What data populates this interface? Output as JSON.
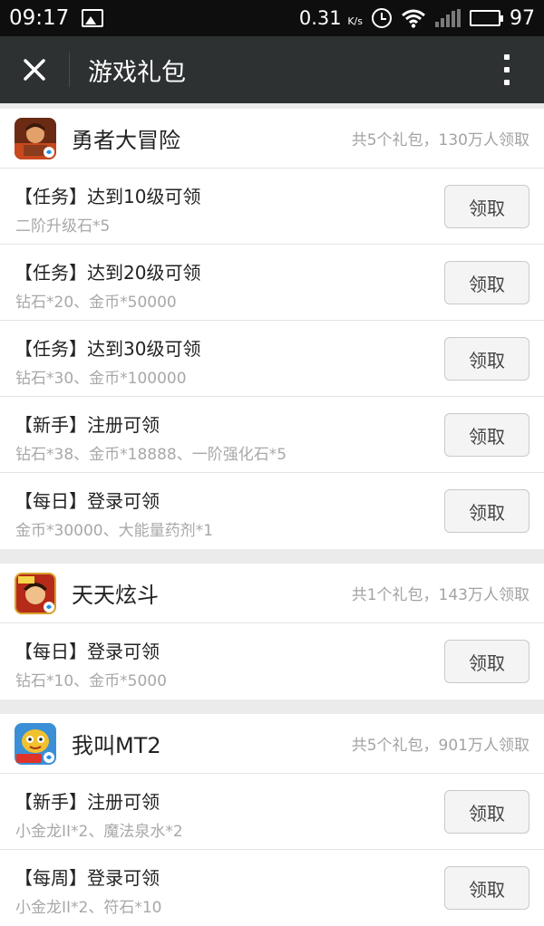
{
  "status_bar": {
    "time": "09:17",
    "speed": "0.31",
    "speed_unit": "K/s",
    "battery": "97"
  },
  "titlebar": {
    "title": "游戏礼包"
  },
  "games": [
    {
      "name": "勇者大冒险",
      "summary": "共5个礼包，130万人领取",
      "icon": "warrior-game-icon",
      "gifts": [
        {
          "title": "【任务】达到10级可领",
          "desc": "二阶升级石*5",
          "button": "领取"
        },
        {
          "title": "【任务】达到20级可领",
          "desc": "钻石*20、金币*50000",
          "button": "领取"
        },
        {
          "title": "【任务】达到30级可领",
          "desc": "钻石*30、金币*100000",
          "button": "领取"
        },
        {
          "title": "【新手】注册可领",
          "desc": "钻石*38、金币*18888、一阶强化石*5",
          "button": "领取"
        },
        {
          "title": "【每日】登录可领",
          "desc": "金币*30000、大能量药剂*1",
          "button": "领取"
        }
      ]
    },
    {
      "name": "天天炫斗",
      "summary": "共1个礼包，143万人领取",
      "icon": "fighter-game-icon",
      "gifts": [
        {
          "title": "【每日】登录可领",
          "desc": "钻石*10、金币*5000",
          "button": "领取"
        }
      ]
    },
    {
      "name": "我叫MT2",
      "summary": "共5个礼包，901万人领取",
      "icon": "mt2-game-icon",
      "gifts": [
        {
          "title": "【新手】注册可领",
          "desc": "小金龙II*2、魔法泉水*2",
          "button": "领取"
        },
        {
          "title": "【每周】登录可领",
          "desc": "小金龙II*2、符石*10",
          "button": "领取"
        }
      ]
    }
  ]
}
